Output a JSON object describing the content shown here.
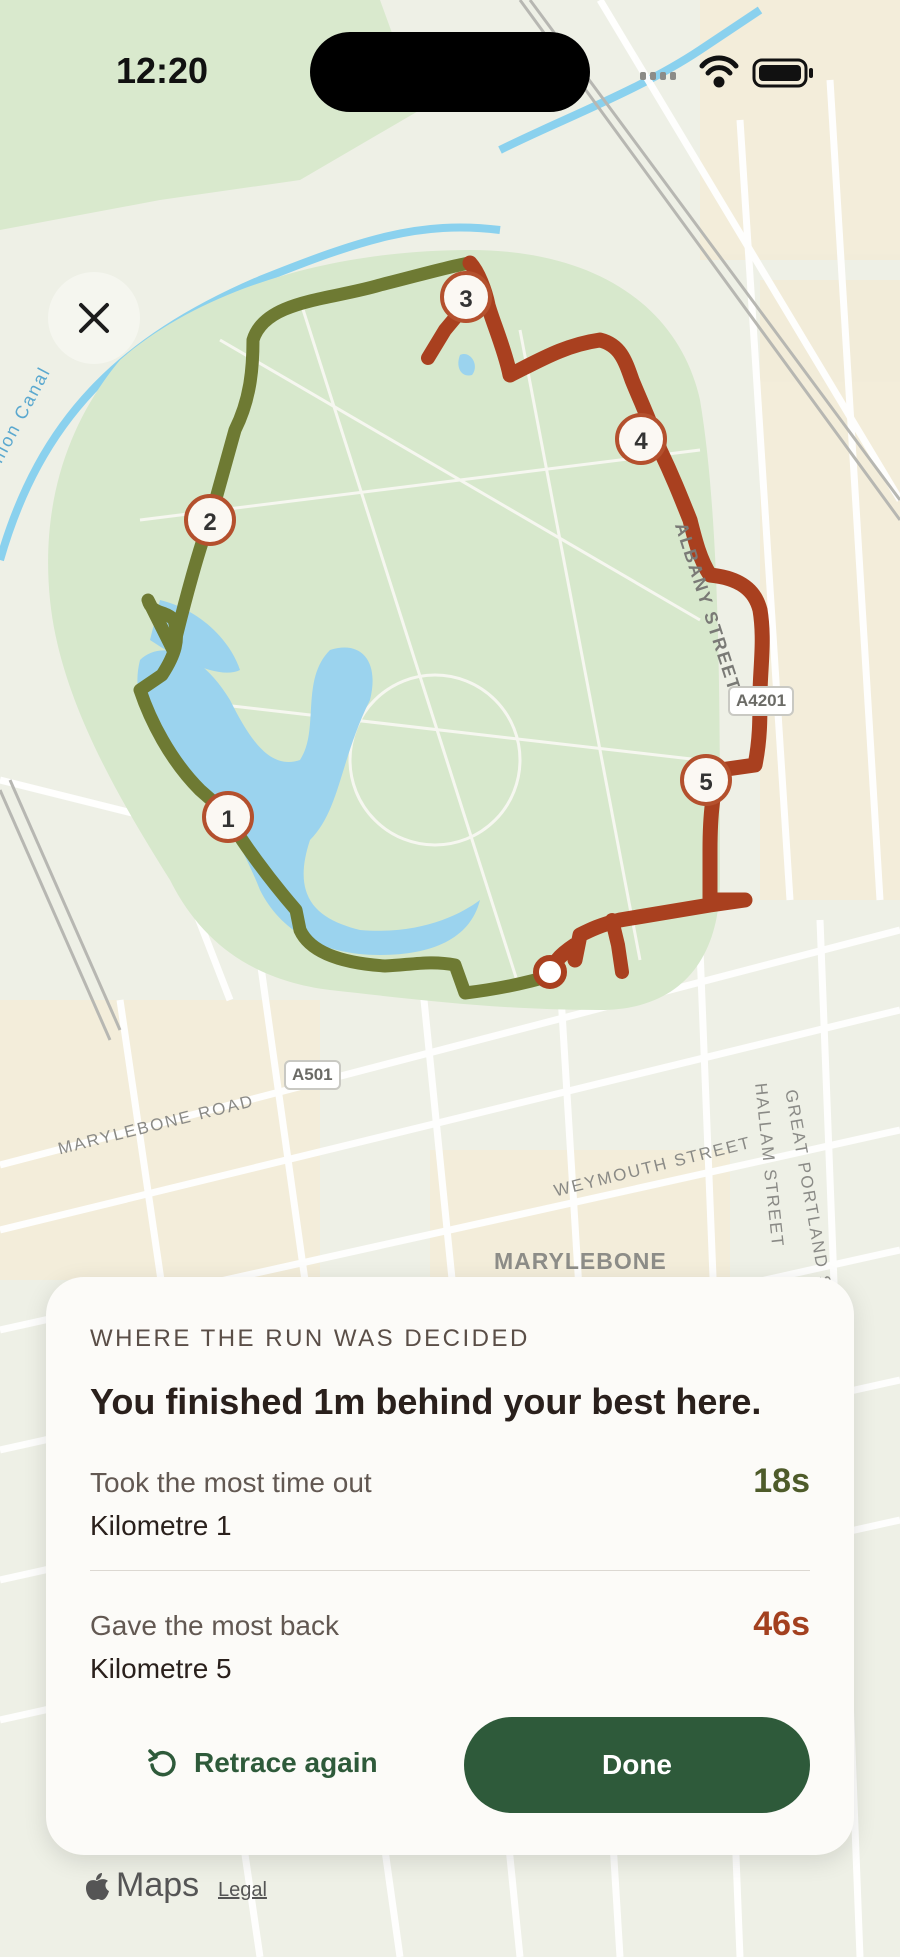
{
  "status_bar": {
    "time": "12:20"
  },
  "map": {
    "labels": {
      "canal": "Union Canal",
      "albany": "ALBANY STREET",
      "marylebone_road": "MARYLEBONE ROAD",
      "weymouth": "WEYMOUTH STREET",
      "hallam": "HALLAM STREET",
      "great_portland": "GREAT PORTLAND STREET",
      "district": "MARYLEBONE"
    },
    "shields": {
      "a4201": "A4201",
      "a501": "A501"
    },
    "km_markers": [
      "1",
      "2",
      "3",
      "4",
      "5"
    ],
    "route_colors": {
      "slower": "#6e7a33",
      "faster": "#a9401f"
    },
    "icons": {
      "close": "close-icon",
      "retrace": "retrace-icon",
      "apple": "apple-logo-icon"
    }
  },
  "summary_card": {
    "eyebrow": "WHERE THE RUN WAS DECIDED",
    "headline": "You finished 1m behind your best here.",
    "rows": [
      {
        "label": "Took the most time out",
        "value": "Kilometre 1",
        "delta": "18s",
        "color": "#4e5b2a"
      },
      {
        "label": "Gave the most back",
        "value": "Kilometre 5",
        "delta": "46s",
        "color": "#a3401f"
      }
    ],
    "retrace_label": "Retrace again",
    "done_label": "Done"
  },
  "attribution": {
    "maps": "Maps",
    "legal": "Legal"
  }
}
